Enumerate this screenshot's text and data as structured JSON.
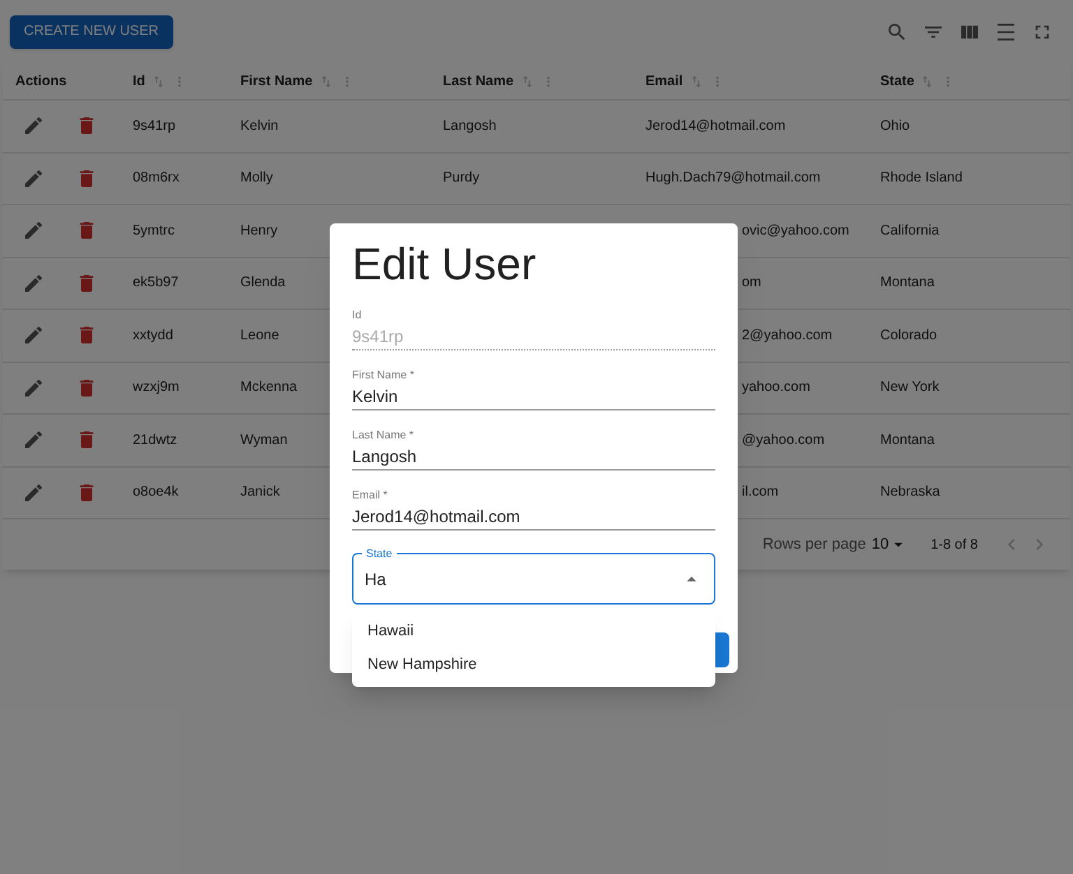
{
  "toolbar": {
    "create_button": "CREATE NEW USER"
  },
  "table": {
    "columns": [
      "Actions",
      "Id",
      "First Name",
      "Last Name",
      "Email",
      "State"
    ],
    "rows": [
      {
        "id": "9s41rp",
        "first_name": "Kelvin",
        "last_name": "Langosh",
        "email": "Jerod14@hotmail.com",
        "state": "Ohio"
      },
      {
        "id": "08m6rx",
        "first_name": "Molly",
        "last_name": "Purdy",
        "email": "Hugh.Dach79@hotmail.com",
        "state": "Rhode Island"
      },
      {
        "id": "5ymtrc",
        "first_name": "Henry",
        "email": "ovic@yahoo.com",
        "state": "California"
      },
      {
        "id": "ek5b97",
        "first_name": "Glenda",
        "email": "om",
        "state": "Montana"
      },
      {
        "id": "xxtydd",
        "first_name": "Leone",
        "email": "2@yahoo.com",
        "state": "Colorado"
      },
      {
        "id": "wzxj9m",
        "first_name": "Mckenna",
        "email": "yahoo.com",
        "state": "New York"
      },
      {
        "id": "21dwtz",
        "first_name": "Wyman",
        "email": "@yahoo.com",
        "state": "Montana"
      },
      {
        "id": "o8oe4k",
        "first_name": "Janick",
        "email": "il.com",
        "state": "Nebraska"
      }
    ]
  },
  "pagination": {
    "rows_per_page_label": "Rows per page",
    "rows_per_page": "10",
    "range": "1-8 of 8"
  },
  "dialog": {
    "title": "Edit User",
    "fields": [
      {
        "kind": "readonly",
        "label": "Id",
        "value": "9s41rp"
      },
      {
        "kind": "text",
        "label": "First Name *",
        "value": "Kelvin"
      },
      {
        "kind": "text",
        "label": "Last Name *",
        "value": "Langosh"
      },
      {
        "kind": "text",
        "label": "Email *",
        "value": "Jerod14@hotmail.com"
      }
    ],
    "state_field": {
      "label": "State",
      "value": "Ha",
      "expanded": true
    },
    "options": [
      "Hawaii",
      "New Hampshire"
    ]
  }
}
